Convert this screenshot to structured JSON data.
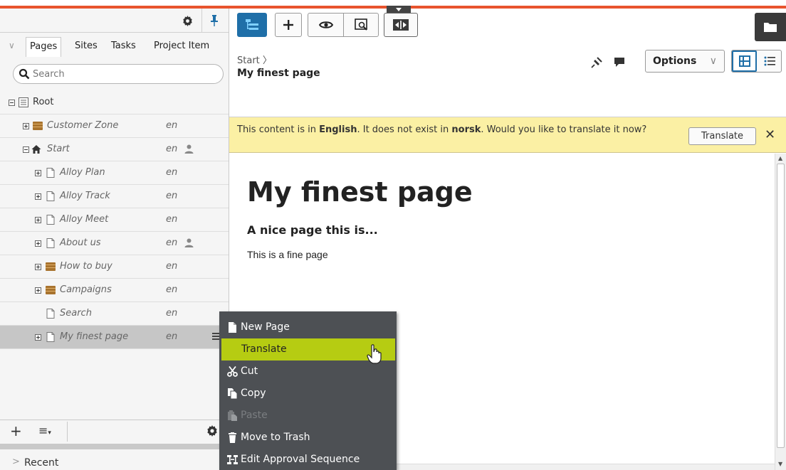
{
  "left_pane": {
    "tabs": [
      "Pages",
      "Sites",
      "Tasks",
      "Project Item"
    ],
    "search_placeholder": "Search",
    "tree": [
      {
        "label": "Root",
        "lang": ""
      },
      {
        "label": "Customer Zone",
        "lang": "en"
      },
      {
        "label": "Start",
        "lang": "en"
      },
      {
        "label": "Alloy Plan",
        "lang": "en"
      },
      {
        "label": "Alloy Track",
        "lang": "en"
      },
      {
        "label": "Alloy Meet",
        "lang": "en"
      },
      {
        "label": "About us",
        "lang": "en"
      },
      {
        "label": "How to buy",
        "lang": "en"
      },
      {
        "label": "Campaigns",
        "lang": "en"
      },
      {
        "label": "Search",
        "lang": "en"
      },
      {
        "label": "My finest page",
        "lang": "en"
      }
    ],
    "recent_label": "Recent"
  },
  "header": {
    "breadcrumb": "Start",
    "page_title": "My finest page",
    "options_label": "Options"
  },
  "banner": {
    "text_1": "This content is in ",
    "from_lang": "English",
    "text_2": ". It does not exist in ",
    "to_lang": "norsk",
    "text_3": ". Would you like to translate it now?",
    "translate_label": "Translate",
    "close_symbol": "✕"
  },
  "content": {
    "heading": "My finest page",
    "subheading": "A nice page this is...",
    "body": "This is a fine page"
  },
  "context_menu": [
    {
      "label": "New Page",
      "icon": "new-page-icon"
    },
    {
      "label": "Translate",
      "icon": ""
    },
    {
      "label": "Cut",
      "icon": "scissors-icon"
    },
    {
      "label": "Copy",
      "icon": "copy-icon"
    },
    {
      "label": "Paste",
      "icon": "paste-icon"
    },
    {
      "label": "Move to Trash",
      "icon": "trash-icon"
    },
    {
      "label": "Edit Approval Sequence",
      "icon": "approval-icon"
    }
  ],
  "colors": {
    "accent_orange": "#e8542e",
    "active_blue": "#1f6fa8",
    "banner_yellow": "#fbf0a4",
    "menu_highlight": "#b6cc12",
    "menu_bg": "#4d5054"
  }
}
